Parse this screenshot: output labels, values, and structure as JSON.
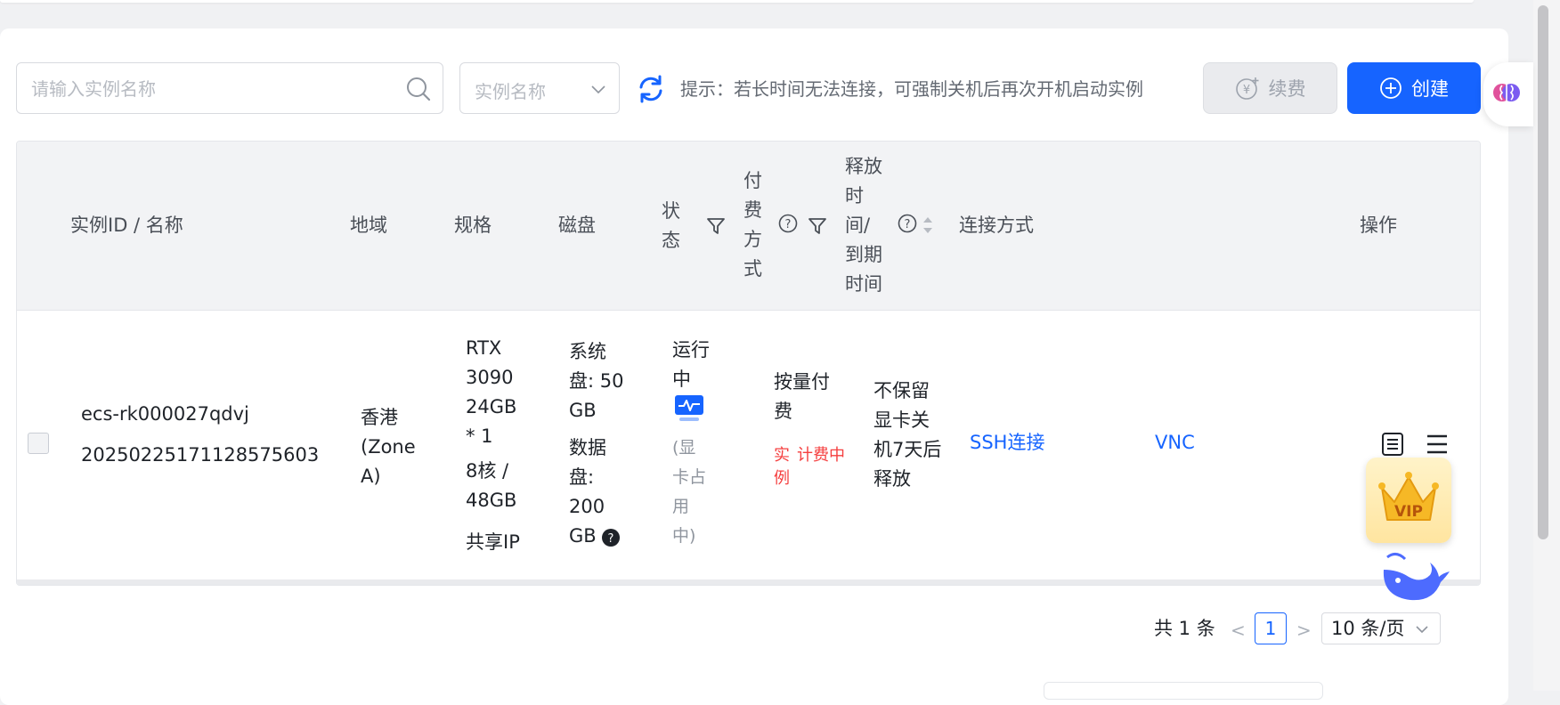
{
  "toolbar": {
    "search_placeholder": "请输入实例名称",
    "select_value": "实例名称",
    "hint": "提示：若长时间无法连接，可强制关机后再次开机启动实例",
    "renew_label": "续费",
    "create_label": "创建"
  },
  "table": {
    "headers": {
      "id_name": "实例ID / 名称",
      "region": "地域",
      "spec": "规格",
      "disk": "磁盘",
      "status": "状态",
      "billing": "付费方式",
      "release": "释放时间/到期时间",
      "connect": "连接方式",
      "ops": "操作"
    },
    "rows": [
      {
        "id": "ecs-rk000027qdvj",
        "name": "20250225171128575603",
        "region": "香港(Zone A)",
        "spec_gpu": "RTX 3090 24GB * 1",
        "spec_cpu": "8核 / 48GB",
        "spec_ip": "共享IP",
        "disk_sys": "系统盘: 50 GB",
        "disk_data": "数据盘: 200 GB",
        "status": "运行中",
        "status_sub": "(显卡占用中)",
        "billing": "按量付费",
        "billing_tag1": "实例",
        "billing_tag2": "计费中",
        "release": "不保留显卡关机7天后释放",
        "ssh": "SSH连接",
        "vnc": "VNC"
      }
    ]
  },
  "pagination": {
    "total": "共 1 条",
    "current": "1",
    "page_size": "10 条/页"
  },
  "colors": {
    "primary": "#1664ff",
    "danger": "#f53f3f",
    "header_bg": "#f2f3f5"
  }
}
